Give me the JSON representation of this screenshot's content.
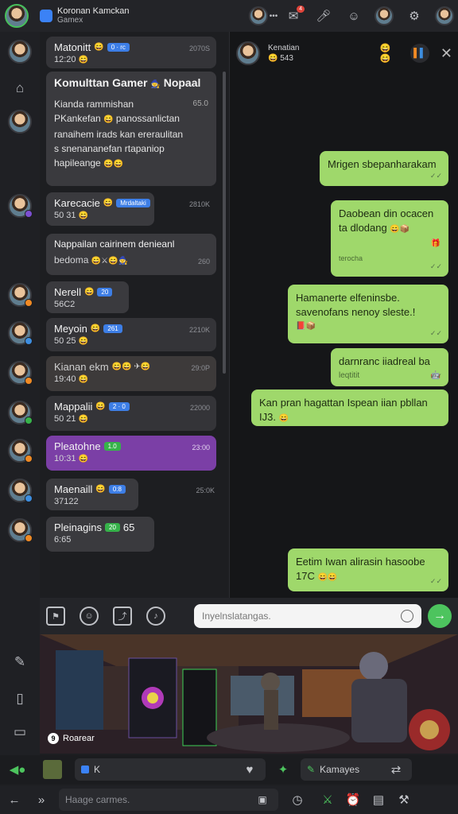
{
  "topbar": {
    "app_title": "Koronan Kamckan",
    "app_subtitle": "Gamex",
    "notif_count": "4",
    "icons": [
      "more-icon",
      "notification-icon",
      "mic-icon",
      "emoji-icon",
      "user-icon",
      "settings-icon",
      "profile-icon"
    ]
  },
  "rail": {
    "icons": [
      "home-icon",
      "tools-icon",
      "tablet-icon",
      "card-icon"
    ]
  },
  "chats": [
    {
      "name": "Matonitt",
      "chip": "0 · rc",
      "sub": "12:20",
      "time": "2070S"
    },
    {
      "name": "Karecacie",
      "chip": "Mrdaltaki",
      "sub": "50 31",
      "time": "2810K"
    },
    {
      "name": "Nerell",
      "chip": "20",
      "sub": "56C2",
      "time": ""
    },
    {
      "name": "Meyoin",
      "chip": "261",
      "sub": "50 25",
      "time": "2210K"
    },
    {
      "name": "Kianan ekm",
      "chip": "",
      "sub": "19:40",
      "time": "29:0P"
    },
    {
      "name": "Mappalii",
      "chip": "2 · 0",
      "sub": "50 21",
      "time": "22000"
    },
    {
      "name": "Pleatohne",
      "chip": "1.0",
      "sub": "10:31",
      "time": "23:00"
    },
    {
      "name": "Maenaill",
      "chip": "0:8",
      "sub": "37122",
      "time": "25:0K"
    },
    {
      "name": "Pleinagins",
      "chip": "20",
      "sub": "6:65",
      "time": "65"
    }
  ],
  "group_card": {
    "title": "Komulttan Gamer",
    "title2": "Nopaal",
    "line1": "Kianda rammishan",
    "time": "65.0",
    "line2": "PKankefan",
    "line2b": "panossanlictan",
    "line3": "ranaihem irads kan ereraulitan",
    "line4": "s snenananefan rtapaniop",
    "line5": "hapileange"
  },
  "note_card": {
    "line1": "Nappailan cairinem denieanl",
    "line2": "bedoma",
    "time": "260"
  },
  "conversation": {
    "name": "Kenatian",
    "sub": "543",
    "messages": [
      {
        "text": "Mrigen sbepanharakam",
        "meta": ""
      },
      {
        "text": "Daobean din ocacen",
        "text2": "ta dlodang",
        "meta": "terocha"
      },
      {
        "text": "Hamanerte elfeninsbe.",
        "text2": "savenofans nenoy sleste.!",
        "meta": ""
      },
      {
        "text": "darnranc iiadreal ba",
        "text2": "leqtitit",
        "meta": ""
      },
      {
        "text": "Kan pran hagattan Ispean iian pbllan",
        "text2": "IJ3.",
        "meta": ""
      },
      {
        "text": "Eetim Iwan alirasin hasoobe",
        "text2": "17C",
        "meta": ""
      }
    ]
  },
  "composer": {
    "placeholder": "Inyelnslatangas."
  },
  "banner": {
    "label": "Roarear"
  },
  "bar2": {
    "left_text": "K",
    "right_text": "Kamayes"
  },
  "bar3": {
    "search_placeholder": "Haage carmes."
  }
}
